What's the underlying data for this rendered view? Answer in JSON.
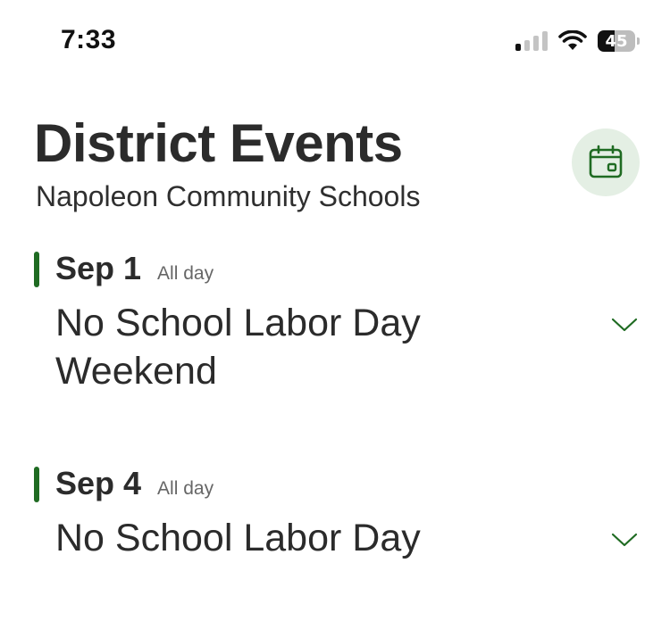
{
  "status_bar": {
    "time": "7:33",
    "battery": "45"
  },
  "header": {
    "title": "District Events",
    "subtitle": "Napoleon Community Schools",
    "calendar_icon": "calendar-icon"
  },
  "events": [
    {
      "date": "Sep 1",
      "time": "All day",
      "title": "No School Labor Day Weekend"
    },
    {
      "date": "Sep 4",
      "time": "All day",
      "title": "No School Labor Day"
    }
  ],
  "colors": {
    "accent": "#1f6b22",
    "calendar_button_bg": "#e4efe4"
  }
}
